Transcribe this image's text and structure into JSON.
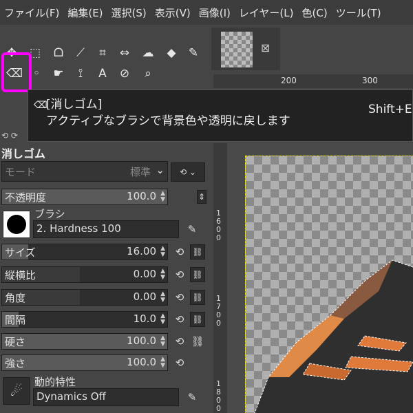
{
  "menu": [
    "ファイル(F)",
    "編集(E)",
    "選択(S)",
    "表示(V)",
    "画像(I)",
    "レイヤー(L)",
    "色(C)",
    "ツール(T)"
  ],
  "tooltip": {
    "title": "[消しゴム]",
    "description": "アクティブなブラシで背景色や透明に戻します",
    "shortcut": "Shift+E"
  },
  "ruler": {
    "h_labels": [
      "200",
      "300"
    ],
    "v_labels": [
      "1600",
      "1700",
      "1800"
    ]
  },
  "options": {
    "title": "消しゴム",
    "mode_label": "モード",
    "mode_value": "標準",
    "opacity_label": "不透明度",
    "opacity_value": "100.0",
    "brush_label": "ブラシ",
    "brush_value": "2. Hardness 100",
    "size_label": "サイズ",
    "size_value": "16.00",
    "aspect_label": "縦横比",
    "aspect_value": "0.00",
    "angle_label": "角度",
    "angle_value": "0.00",
    "spacing_label": "間隔",
    "spacing_value": "10.0",
    "hardness_label": "硬さ",
    "hardness_value": "100.0",
    "force_label": "強さ",
    "force_value": "100.0",
    "dynamics_label": "動的特性",
    "dynamics_value": "Dynamics Off"
  },
  "fill_levels": {
    "opacity": 1.0,
    "size": 0.16,
    "spacing": 0.1,
    "hardness": 1.0,
    "force": 1.0
  },
  "colors": {
    "highlight": "#ff00ff",
    "orange": "#e07a3a"
  }
}
